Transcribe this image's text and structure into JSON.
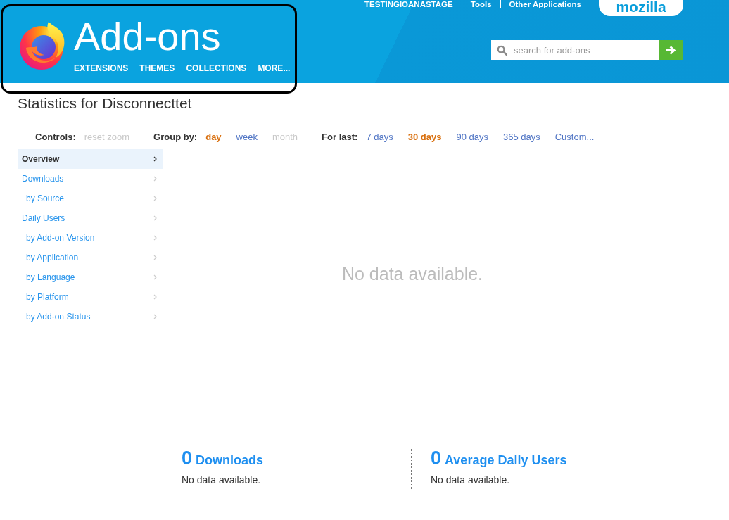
{
  "header": {
    "top_links": [
      "TESTINGIOANASTAGE",
      "Tools",
      "Other Applications"
    ],
    "brand_tab": "mozilla",
    "title": "Add-ons",
    "nav": [
      "EXTENSIONS",
      "THEMES",
      "COLLECTIONS",
      "MORE..."
    ],
    "search": {
      "placeholder": "search for add-ons"
    }
  },
  "page_title": "Statistics for Disconnecttet",
  "controls": {
    "label": "Controls:",
    "items": [
      {
        "label": "reset zoom",
        "disabled": true
      }
    ]
  },
  "group_by": {
    "label": "Group by:",
    "options": [
      {
        "label": "day",
        "selected": true,
        "disabled": false
      },
      {
        "label": "week",
        "selected": false,
        "disabled": false
      },
      {
        "label": "month",
        "selected": false,
        "disabled": true
      }
    ]
  },
  "for_last": {
    "label": "For last:",
    "options": [
      {
        "label": "7 days",
        "selected": false
      },
      {
        "label": "30 days",
        "selected": true
      },
      {
        "label": "90 days",
        "selected": false
      },
      {
        "label": "365 days",
        "selected": false
      },
      {
        "label": "Custom...",
        "selected": false
      }
    ]
  },
  "sidebar": {
    "items": [
      {
        "label": "Overview",
        "selected": true
      },
      {
        "label": "Downloads",
        "selected": false,
        "children": [
          {
            "label": "by Source",
            "selected": false
          }
        ]
      },
      {
        "label": "Daily Users",
        "selected": false,
        "children": [
          {
            "label": "by Add-on Version",
            "selected": false
          },
          {
            "label": "by Application",
            "selected": false
          },
          {
            "label": "by Language",
            "selected": false
          },
          {
            "label": "by Platform",
            "selected": false
          },
          {
            "label": "by Add-on Status",
            "selected": false
          }
        ]
      }
    ]
  },
  "chart": {
    "message": "No data available."
  },
  "summary": [
    {
      "count": "0",
      "label": "Downloads",
      "note": "No data available."
    },
    {
      "count": "0",
      "label": "Average Daily Users",
      "note": "No data available."
    }
  ],
  "highlight": {
    "kind": "rounded-frame"
  }
}
